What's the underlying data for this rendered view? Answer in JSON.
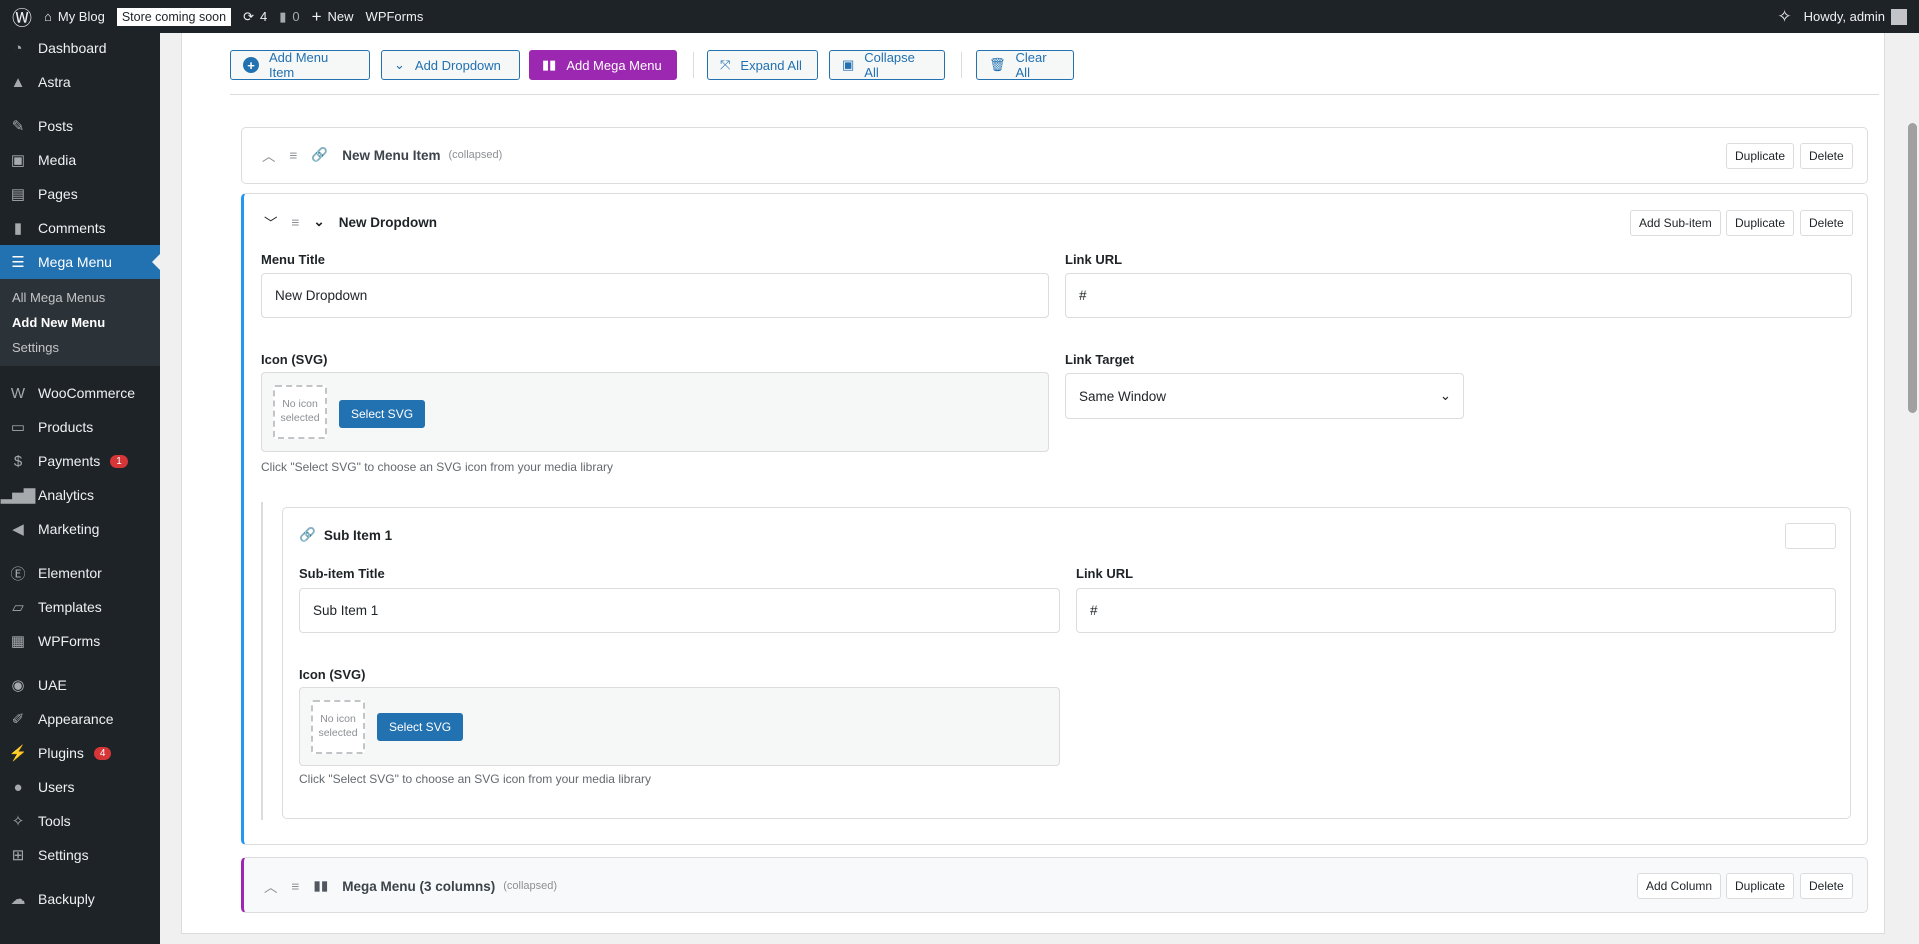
{
  "topbar": {
    "site": "My Blog",
    "store_badge": "Store coming soon",
    "updates": "4",
    "comments": "0",
    "new": "New",
    "wpforms": "WPForms",
    "howdy": "Howdy, admin"
  },
  "sidebar": {
    "items": [
      {
        "label": "Dashboard",
        "icon": "dashboard-icon"
      },
      {
        "label": "Astra",
        "icon": "astra-icon"
      },
      {
        "label": "Posts",
        "icon": "pin-icon"
      },
      {
        "label": "Media",
        "icon": "media-icon"
      },
      {
        "label": "Pages",
        "icon": "pages-icon"
      },
      {
        "label": "Comments",
        "icon": "comment-icon"
      },
      {
        "label": "Mega Menu",
        "icon": "menu-icon"
      },
      {
        "label": "WooCommerce",
        "icon": "woo-icon"
      },
      {
        "label": "Products",
        "icon": "archive-icon"
      },
      {
        "label": "Payments",
        "icon": "dollar-icon",
        "badge": "1"
      },
      {
        "label": "Analytics",
        "icon": "bar-chart-icon"
      },
      {
        "label": "Marketing",
        "icon": "megaphone-icon"
      },
      {
        "label": "Elementor",
        "icon": "elementor-icon"
      },
      {
        "label": "Templates",
        "icon": "folder-icon"
      },
      {
        "label": "WPForms",
        "icon": "form-icon"
      },
      {
        "label": "UAE",
        "icon": "uae-icon"
      },
      {
        "label": "Appearance",
        "icon": "brush-icon"
      },
      {
        "label": "Plugins",
        "icon": "plug-icon",
        "badge": "4"
      },
      {
        "label": "Users",
        "icon": "user-icon"
      },
      {
        "label": "Tools",
        "icon": "wrench-icon"
      },
      {
        "label": "Settings",
        "icon": "settings-icon"
      },
      {
        "label": "Backuply",
        "icon": "cloud-upload-icon"
      }
    ],
    "submenu": [
      "All Mega Menus",
      "Add New Menu",
      "Settings"
    ]
  },
  "toolbar": {
    "add_menu_item": "Add Menu Item",
    "add_dropdown": "Add Dropdown",
    "add_mega_menu": "Add Mega Menu",
    "expand_all": "Expand All",
    "collapse_all": "Collapse All",
    "clear_all": "Clear All"
  },
  "colors": {
    "accent": "#2271b1",
    "mega": "#9c27b0",
    "dropdown_border": "#2196f3"
  },
  "items": {
    "menu_item": {
      "title": "New Menu Item",
      "state": "(collapsed)",
      "duplicate": "Duplicate",
      "delete": "Delete"
    },
    "dropdown": {
      "title": "New Dropdown",
      "add_sub": "Add Sub-item",
      "duplicate": "Duplicate",
      "delete": "Delete",
      "menu_title_label": "Menu Title",
      "menu_title_value": "New Dropdown",
      "link_url_label": "Link URL",
      "link_url_value": "#",
      "icon_label": "Icon (SVG)",
      "no_icon": "No icon selected",
      "select_svg": "Select SVG",
      "help": "Click \"Select SVG\" to choose an SVG icon from your media library",
      "link_target_label": "Link Target",
      "link_target_value": "Same Window",
      "sub": {
        "title": "Sub Item 1",
        "title_label": "Sub-item Title",
        "title_value": "Sub Item 1",
        "link_url_label": "Link URL",
        "link_url_value": "#",
        "icon_label": "Icon (SVG)",
        "no_icon": "No icon selected",
        "select_svg": "Select SVG",
        "help": "Click \"Select SVG\" to choose an SVG icon from your media library"
      }
    },
    "mega": {
      "title": "Mega Menu (3 columns)",
      "state": "(collapsed)",
      "add_column": "Add Column",
      "duplicate": "Duplicate",
      "delete": "Delete"
    }
  }
}
